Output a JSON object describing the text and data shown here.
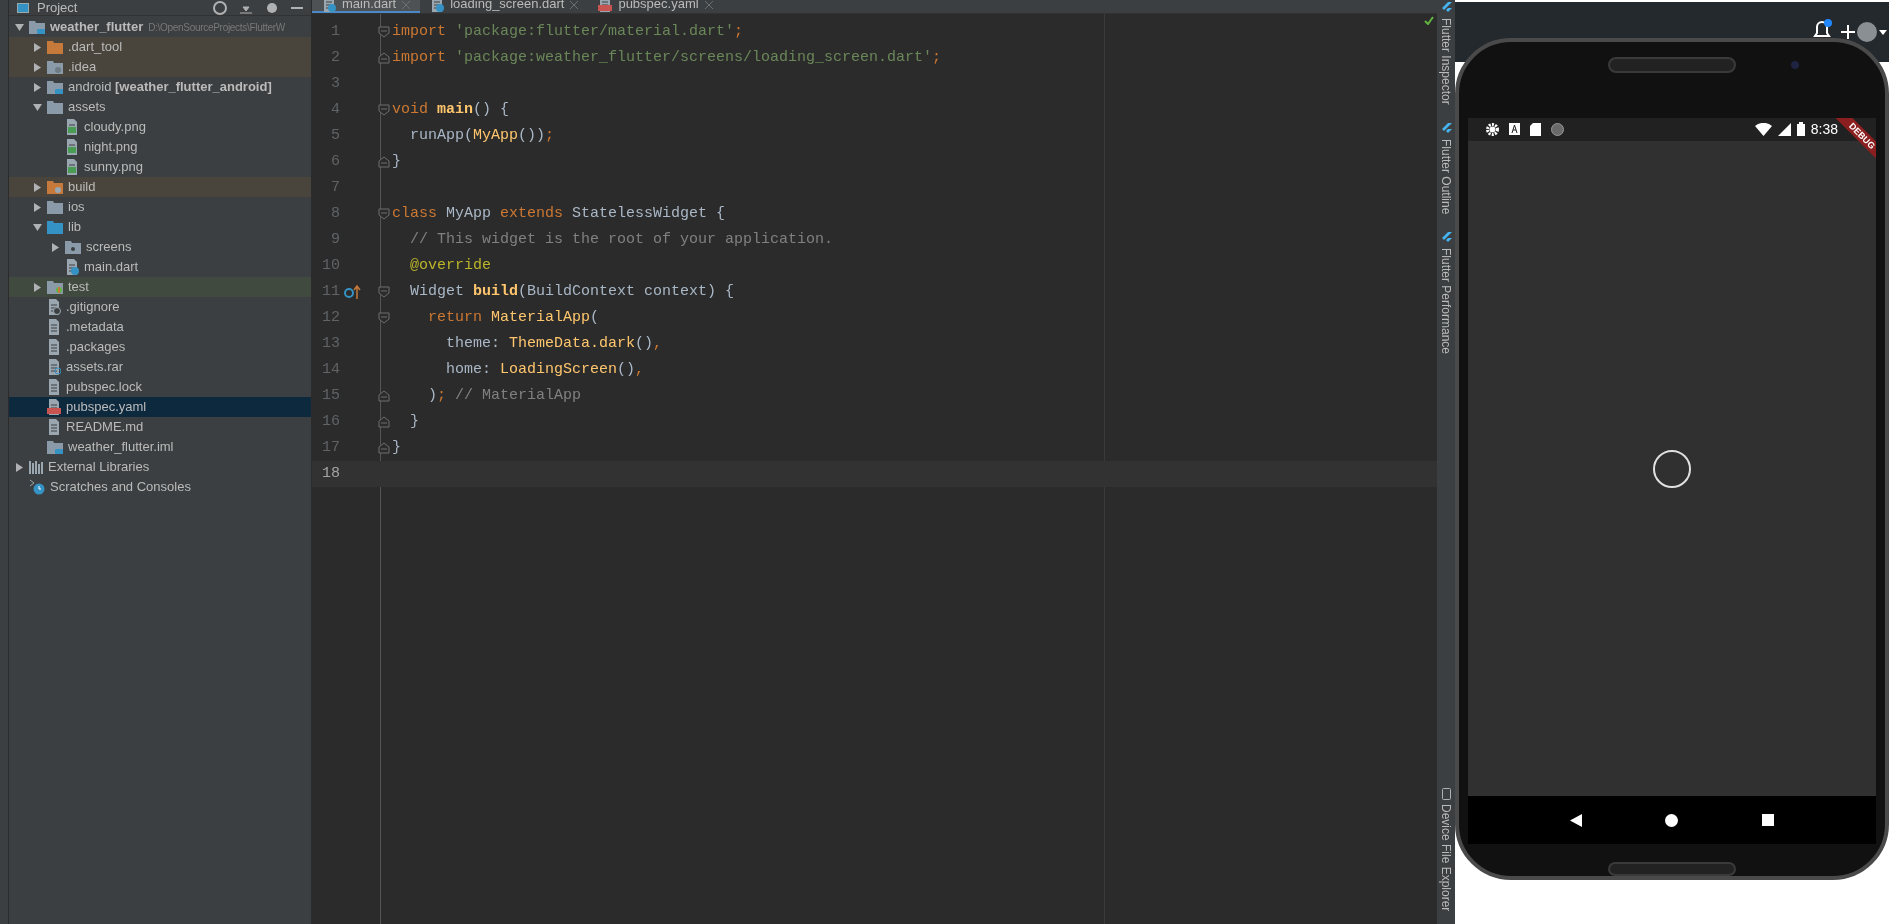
{
  "project_panel": {
    "title": "Project",
    "tree": [
      {
        "label": "weather_flutter",
        "path": "D:\\OpenSourceProjects\\FlutterW",
        "kind": "module",
        "expanded": true,
        "selected": false,
        "children": [
          {
            "label": ".dart_tool",
            "kind": "folder-orange",
            "expanded": false,
            "selected": false,
            "color": "#4a453c"
          },
          {
            "label": ".idea",
            "kind": "folder-gear",
            "expanded": false,
            "selected": false,
            "color": "#4a453c"
          },
          {
            "label": "android **[weather_flutter_android]**",
            "kind": "module",
            "expanded": false,
            "selected": false
          },
          {
            "label": "assets",
            "kind": "folder",
            "expanded": true,
            "selected": false,
            "children": [
              {
                "label": "cloudy.png",
                "kind": "image",
                "selected": false
              },
              {
                "label": "night.png",
                "kind": "image",
                "selected": false
              },
              {
                "label": "sunny.png",
                "kind": "image",
                "selected": false
              }
            ]
          },
          {
            "label": "build",
            "kind": "folder-orange-gear",
            "expanded": false,
            "selected": false,
            "color": "#4a453c"
          },
          {
            "label": "ios",
            "kind": "folder",
            "expanded": false,
            "selected": false
          },
          {
            "label": "lib",
            "kind": "folder-blue",
            "expanded": true,
            "selected": false,
            "children": [
              {
                "label": "screens",
                "kind": "package",
                "expanded": false,
                "selected": false
              },
              {
                "label": "main.dart",
                "kind": "dart",
                "selected": false
              }
            ]
          },
          {
            "label": "test",
            "kind": "folder-test",
            "expanded": false,
            "selected": false,
            "color": "#414a3f"
          },
          {
            "label": ".gitignore",
            "kind": "ignore",
            "selected": false
          },
          {
            "label": ".metadata",
            "kind": "text",
            "selected": false
          },
          {
            "label": ".packages",
            "kind": "text",
            "selected": false
          },
          {
            "label": "assets.rar",
            "kind": "unknown",
            "selected": false
          },
          {
            "label": "pubspec.lock",
            "kind": "text",
            "selected": false
          },
          {
            "label": "pubspec.yaml",
            "kind": "yaml",
            "selected": true
          },
          {
            "label": "README.md",
            "kind": "text",
            "selected": false
          },
          {
            "label": "weather_flutter.iml",
            "kind": "module",
            "selected": false
          }
        ]
      },
      {
        "label": "External Libraries",
        "kind": "library",
        "expanded": false,
        "selected": false
      },
      {
        "label": "Scratches and Consoles",
        "kind": "scratch",
        "selected": false
      }
    ]
  },
  "editor": {
    "tabs": [
      {
        "label": "main.dart",
        "kind": "dart",
        "selected": true
      },
      {
        "label": "loading_screen.dart",
        "kind": "dart",
        "selected": false
      },
      {
        "label": "pubspec.yaml",
        "kind": "yaml",
        "selected": false
      }
    ],
    "lines": [
      {
        "number": "1",
        "fold_start": true,
        "tokens": [
          {
            "kind": "keyword",
            "t": "import "
          },
          {
            "kind": "string",
            "t": "'package:flutter/material.dart'"
          },
          {
            "kind": "keyword",
            "t": ";"
          }
        ]
      },
      {
        "number": "2",
        "fold_end": true,
        "tokens": [
          {
            "kind": "keyword",
            "t": "import "
          },
          {
            "kind": "string",
            "t": "'package:weather_flutter/screens/loading_screen.dart'"
          },
          {
            "kind": "keyword",
            "t": ";"
          }
        ]
      },
      {
        "number": "3"
      },
      {
        "number": "4",
        "fold_start": true,
        "tokens": [
          {
            "kind": "keyword",
            "t": "void "
          },
          {
            "kind": "function",
            "t": "main"
          },
          {
            "kind": "plain",
            "t": "() {"
          }
        ]
      },
      {
        "number": "5",
        "tokens": [
          {
            "kind": "plain",
            "t": "  runApp("
          },
          {
            "kind": "class",
            "t": "MyApp"
          },
          {
            "kind": "plain",
            "t": "())"
          },
          {
            "kind": "keyword",
            "t": ";"
          }
        ]
      },
      {
        "number": "6",
        "fold_end": true,
        "tokens": [
          {
            "kind": "plain",
            "t": "}"
          }
        ]
      },
      {
        "number": "7"
      },
      {
        "number": "8",
        "fold_start": true,
        "tokens": [
          {
            "kind": "keyword",
            "t": "class "
          },
          {
            "kind": "plain",
            "t": "MyApp "
          },
          {
            "kind": "keyword",
            "t": "extends "
          },
          {
            "kind": "plain",
            "t": "StatelessWidget {"
          }
        ]
      },
      {
        "number": "9",
        "tokens": [
          {
            "kind": "comment",
            "t": "  // This widget is the root of your application."
          }
        ]
      },
      {
        "number": "10",
        "tokens": [
          {
            "kind": "annotation",
            "t": "  @override"
          }
        ]
      },
      {
        "number": "11",
        "fold_start": true,
        "override_marker": true,
        "tokens": [
          {
            "kind": "plain",
            "t": "  Widget "
          },
          {
            "kind": "function",
            "t": "build"
          },
          {
            "kind": "plain",
            "t": "(BuildContext context) {"
          }
        ]
      },
      {
        "number": "12",
        "fold_start": true,
        "tokens": [
          {
            "kind": "keyword",
            "t": "    return "
          },
          {
            "kind": "class",
            "t": "MaterialApp"
          },
          {
            "kind": "plain",
            "t": "("
          }
        ]
      },
      {
        "number": "13",
        "tokens": [
          {
            "kind": "plain",
            "t": "      theme: "
          },
          {
            "kind": "class",
            "t": "ThemeData.dark"
          },
          {
            "kind": "plain",
            "t": "()"
          },
          {
            "kind": "keyword",
            "t": ","
          }
        ]
      },
      {
        "number": "14",
        "tokens": [
          {
            "kind": "plain",
            "t": "      home: "
          },
          {
            "kind": "class",
            "t": "LoadingScreen"
          },
          {
            "kind": "plain",
            "t": "()"
          },
          {
            "kind": "keyword",
            "t": ","
          }
        ]
      },
      {
        "number": "15",
        "fold_end": true,
        "tokens": [
          {
            "kind": "plain",
            "t": "    )"
          },
          {
            "kind": "keyword",
            "t": "; "
          },
          {
            "kind": "comment",
            "t": "// MaterialApp"
          }
        ]
      },
      {
        "number": "16",
        "fold_end": true,
        "tokens": [
          {
            "kind": "plain",
            "t": "  }"
          }
        ]
      },
      {
        "number": "17",
        "fold_end": true,
        "tokens": [
          {
            "kind": "plain",
            "t": "}"
          }
        ]
      },
      {
        "number": "18",
        "current": true
      }
    ]
  },
  "tool_windows": [
    {
      "label": "Flutter Inspector",
      "kind": "flutter"
    },
    {
      "label": "Flutter Outline",
      "kind": "flutter"
    },
    {
      "label": "Flutter Performance",
      "kind": "flutter"
    },
    {
      "label": "Device File Explorer",
      "kind": "device"
    }
  ],
  "emulator": {
    "time": "8:38",
    "debug_banner": "DEBUG"
  }
}
